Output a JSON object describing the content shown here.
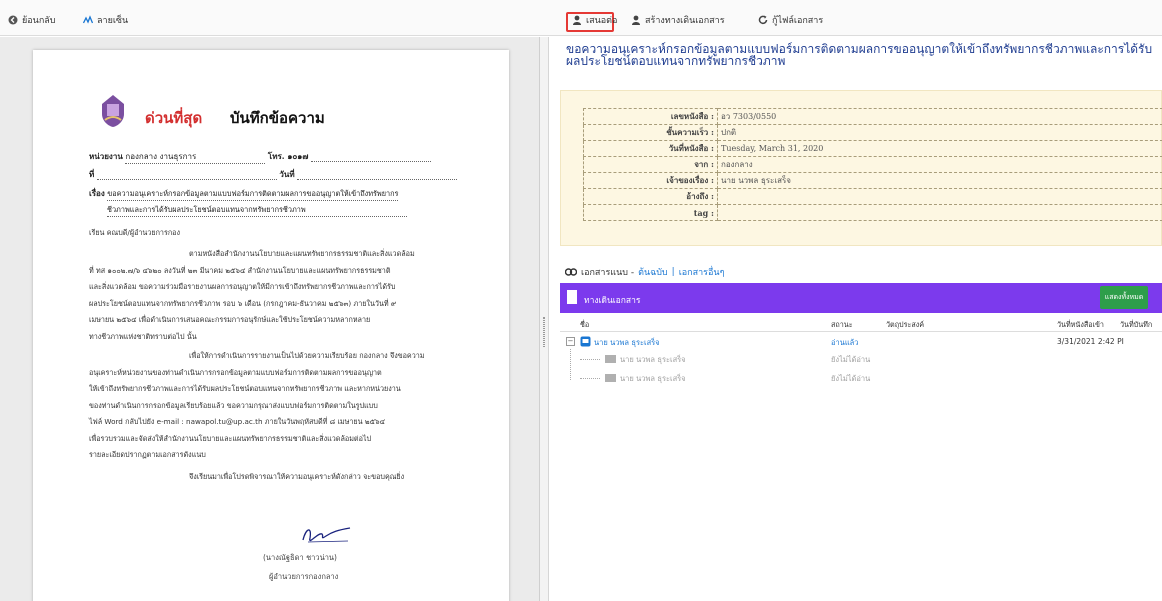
{
  "toolbar": {
    "back_label": "ย้อนกลับ",
    "signature_label": "ลายเซ็น",
    "propose_label": "เสนอต่อ",
    "create_route_label": "สร้างทางเดินเอกสาร",
    "restore_label": "กู้ไฟล์เอกสาร"
  },
  "document": {
    "urgency": "ด่วนที่สุด",
    "memo_title": "บันทึกข้อความ",
    "agency_label": "หน่วยงาน",
    "agency_value": "กองกลาง งานธุรการ",
    "tel_label": "โทร. ๑๐๑๗",
    "no_label": "ที่",
    "date_label": "วันที่",
    "subject_label": "เรื่อง",
    "subject_line1": "ขอความอนุเคราะห์กรอกข้อมูลตามแบบฟอร์มการติดตามผลการขออนุญาตให้เข้าถึงทรัพยากร",
    "subject_line2": "ชีวภาพและการได้รับผลประโยชน์ตอบแทนจากทรัพยากรชีวภาพ",
    "to_line": "เรียน คณบดี/ผู้อำนวยการกอง",
    "para1": [
      "ตามหนังสือสำนักงานนโยบายและแผนทรัพยากรธรรมชาติและสิ่งแวดล้อม",
      "ที่ ทส ๑๐๐๒.๗/๖ ๔๖๒๐ ลงวันที่ ๒๓ มีนาคม ๒๕๖๔ สำนักงานนโยบายและแผนทรัพยากรธรรมชาติ",
      "และสิ่งแวดล้อม ขอความร่วมมือรายงานผลการอนุญาตให้มีการเข้าถึงทรัพยากรชีวภาพและการได้รับ",
      "ผลประโยชน์ตอบแทนจากทรัพยากรชีวภาพ รอบ ๖ เดือน (กรกฎาคม-ธันวาคม ๒๕๖๓) ภายในวันที่ ๙",
      "เมษายน ๒๕๖๔ เพื่อดำเนินการเสนอคณะกรรมการอนุรักษ์และใช้ประโยชน์ความหลากหลาย",
      "ทางชีวภาพแห่งชาติทราบต่อไป นั้น"
    ],
    "para2": [
      "เพื่อให้การดำเนินการรายงานเป็นไปด้วยความเรียบร้อย กองกลาง จึงขอความ",
      "อนุเคราะห์หน่วยงานของท่านดำเนินการกรอกข้อมูลตามแบบฟอร์มการติดตามผลการขออนุญาต",
      "ให้เข้าถึงทรัพยากรชีวภาพและการได้รับผลประโยชน์ตอบแทนจากทรัพยากรชีวภาพ และหากหน่วยงาน",
      "ของท่านดำเนินการกรอกข้อมูลเรียบร้อยแล้ว ขอความกรุณาส่งแบบฟอร์มการติดตามในรูปแบบ",
      "ไฟล์ Word กลับไปยัง e-mail : nawapol.tu@up.ac.th ภายในวันพฤหัสบดีที่ ๘ เมษายน ๒๕๖๔",
      "เพื่อรวบรวมและจัดส่งให้สำนักงานนโยบายและแผนทรัพยากรธรรมชาติและสิ่งแวดล้อมต่อไป",
      "รายละเอียดปรากฏตามเอกสารดังแนบ"
    ],
    "closing": "จึงเรียนมาเพื่อโปรดพิจารณาให้ความอนุเคราะห์ดังกล่าว จะขอบคุณยิ่ง",
    "signer_name": "(นางณัฐธิดา ชาวน่าน)",
    "signer_position": "ผู้อำนวยการกองกลาง"
  },
  "detail": {
    "subject": "ขอความอนุเคราะห์กรอกข้อมูลตามแบบฟอร์มการติดตามผลการขออนุญาตให้เข้าถึงทรัพยากรชีวภาพและการได้รับผลประโยชน์ตอบแทนจากทรัพยากรชีวภาพ",
    "fields": [
      {
        "label": "เลขหนังสือ :",
        "value": "อว 7303/0550"
      },
      {
        "label": "ชั้นความเร็ว :",
        "value": "ปกติ"
      },
      {
        "label": "วันที่หนังสือ :",
        "value": "Tuesday, March 31, 2020"
      },
      {
        "label": "จาก :",
        "value": "กองกลาง"
      },
      {
        "label": "เจ้าของเรื่อง :",
        "value": "นาย นวพล ธุระเสร็จ"
      },
      {
        "label": "อ้างถึง :",
        "value": ""
      },
      {
        "label": "tag :",
        "value": ""
      }
    ]
  },
  "attachments": {
    "label": "เอกสารแนบ -",
    "original_link": "ต้นฉบับ",
    "separator": "|",
    "other_link": "เอกสารอื่นๆ"
  },
  "route": {
    "title": "ทางเดินเอกสาร",
    "show_all": "แสดงทั้งหมด",
    "colors": {
      "bar": "#7c3aed",
      "button": "#2e9e4a"
    },
    "columns": [
      "ชื่อ",
      "สถานะ",
      "วัตถุประสงค์",
      "วันที่หนังสือเข้า",
      "วันที่บันทึก"
    ],
    "rows": [
      {
        "name": "นาย นวพล ธุระเสร็จ",
        "status": "อ่านแล้ว",
        "purpose": "",
        "received": "3/31/2021 2:42 PI",
        "recorded": ""
      },
      {
        "name": "นาย นวพล ธุระเสร็จ",
        "status": "ยังไม่ได้อ่าน"
      },
      {
        "name": "นาย นวพล ธุระเสร็จ",
        "status": "ยังไม่ได้อ่าน"
      }
    ]
  }
}
